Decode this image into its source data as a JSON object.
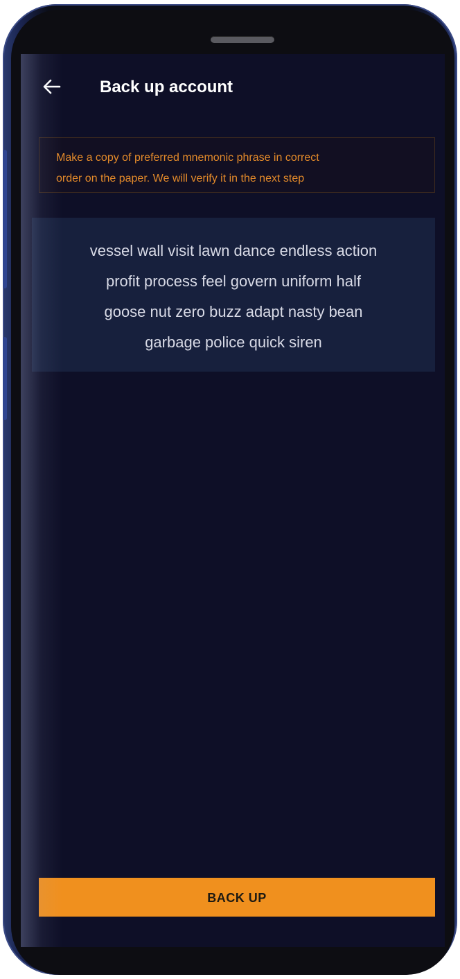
{
  "header": {
    "title": "Back up account",
    "back_icon": "arrow-left-icon"
  },
  "notice": {
    "lines": [
      "Make a copy of preferred mnemonic phrase in correct",
      "order on the paper. We will verify it in the next step"
    ]
  },
  "mnemonic": {
    "lines": [
      "vessel wall visit lawn dance endless action",
      "profit process feel govern uniform half",
      "goose nut zero buzz adapt nasty bean",
      "garbage police quick siren"
    ]
  },
  "actions": {
    "backup_label": "BACK UP"
  },
  "colors": {
    "background": "#0e0f27",
    "accent": "#f0901e",
    "notice_text": "#e38a2a",
    "phrase_box": "#17203d"
  }
}
